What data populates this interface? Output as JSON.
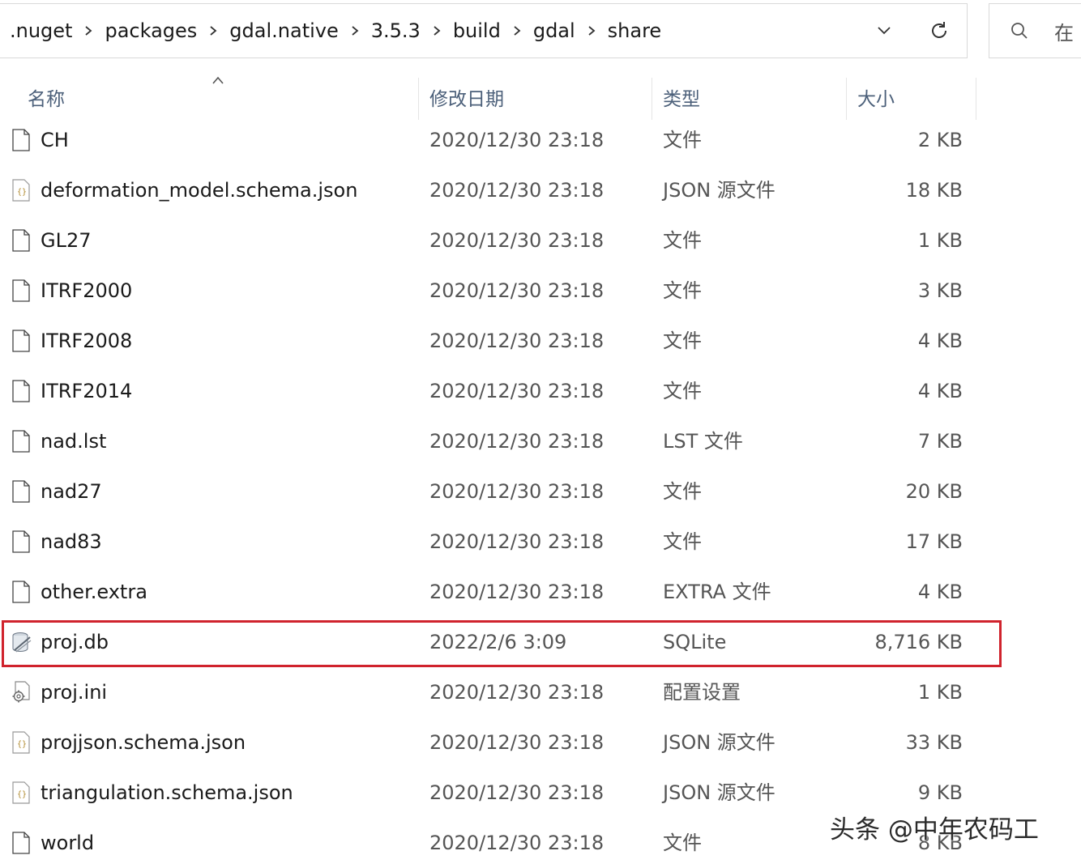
{
  "breadcrumb": [
    ".nuget",
    "packages",
    "gdal.native",
    "3.5.3",
    "build",
    "gdal",
    "share"
  ],
  "search": {
    "placeholder": "在"
  },
  "columns": {
    "name": "名称",
    "modified": "修改日期",
    "type": "类型",
    "size": "大小"
  },
  "files": [
    {
      "icon": "file-icon",
      "name": "CH",
      "modified": "2020/12/30 23:18",
      "type": "文件",
      "size": "2 KB"
    },
    {
      "icon": "json-file-icon",
      "name": "deformation_model.schema.json",
      "modified": "2020/12/30 23:18",
      "type": "JSON 源文件",
      "size": "18 KB"
    },
    {
      "icon": "file-icon",
      "name": "GL27",
      "modified": "2020/12/30 23:18",
      "type": "文件",
      "size": "1 KB"
    },
    {
      "icon": "file-icon",
      "name": "ITRF2000",
      "modified": "2020/12/30 23:18",
      "type": "文件",
      "size": "3 KB"
    },
    {
      "icon": "file-icon",
      "name": "ITRF2008",
      "modified": "2020/12/30 23:18",
      "type": "文件",
      "size": "4 KB"
    },
    {
      "icon": "file-icon",
      "name": "ITRF2014",
      "modified": "2020/12/30 23:18",
      "type": "文件",
      "size": "4 KB"
    },
    {
      "icon": "file-icon",
      "name": "nad.lst",
      "modified": "2020/12/30 23:18",
      "type": "LST 文件",
      "size": "7 KB"
    },
    {
      "icon": "file-icon",
      "name": "nad27",
      "modified": "2020/12/30 23:18",
      "type": "文件",
      "size": "20 KB"
    },
    {
      "icon": "file-icon",
      "name": "nad83",
      "modified": "2020/12/30 23:18",
      "type": "文件",
      "size": "17 KB"
    },
    {
      "icon": "file-icon",
      "name": "other.extra",
      "modified": "2020/12/30 23:18",
      "type": "EXTRA 文件",
      "size": "4 KB"
    },
    {
      "icon": "sqlite-file-icon",
      "name": "proj.db",
      "modified": "2022/2/6 3:09",
      "type": "SQLite",
      "size": "8,716 KB"
    },
    {
      "icon": "settings-file-icon",
      "name": "proj.ini",
      "modified": "2020/12/30 23:18",
      "type": "配置设置",
      "size": "1 KB"
    },
    {
      "icon": "json-file-icon",
      "name": "projjson.schema.json",
      "modified": "2020/12/30 23:18",
      "type": "JSON 源文件",
      "size": "33 KB"
    },
    {
      "icon": "json-file-icon",
      "name": "triangulation.schema.json",
      "modified": "2020/12/30 23:18",
      "type": "JSON 源文件",
      "size": "9 KB"
    },
    {
      "icon": "file-icon",
      "name": "world",
      "modified": "2020/12/30 23:18",
      "type": "文件",
      "size": "8 KB"
    }
  ],
  "highlight_color": "#d0232d",
  "watermark": "头条 @中年农码工"
}
